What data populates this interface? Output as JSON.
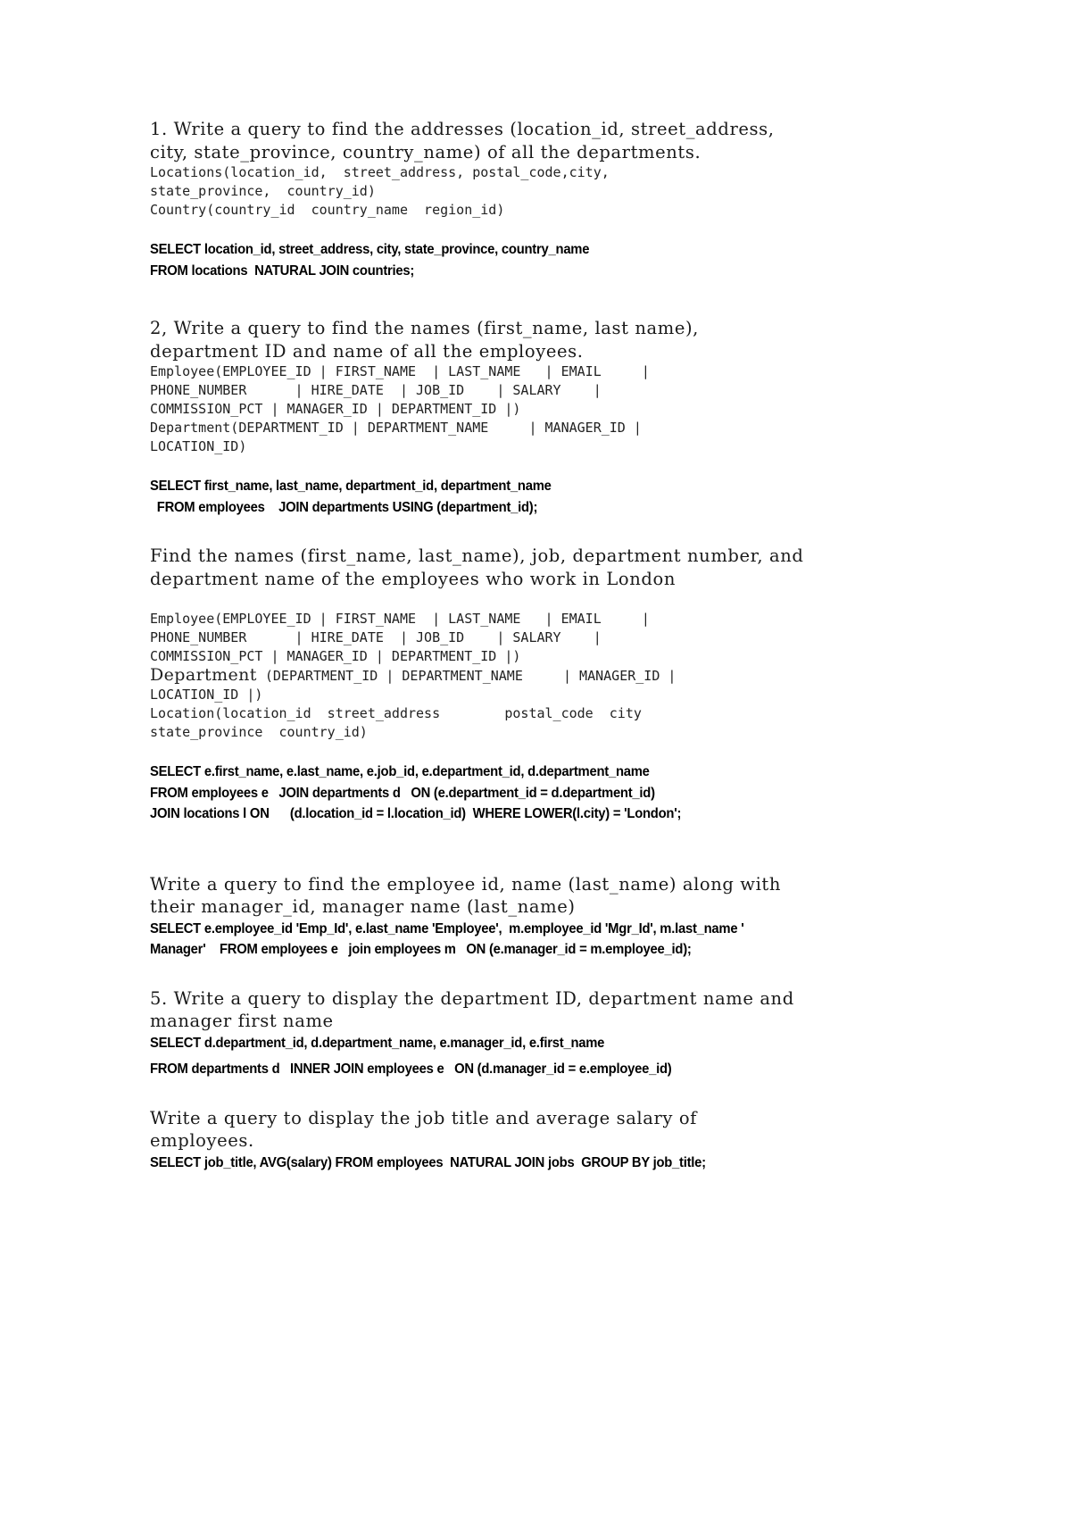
{
  "document": {
    "title": "SQL Joins Exercise Answer Sheet",
    "page_background": "#ffffff",
    "text_color": "#000000"
  },
  "sections": [
    {
      "id": "q1",
      "question": "1. Write a query to find the addresses (location_id, street_address,\ncity, state_province, country_name) of all the departments.",
      "schema_lines": [
        "Locations(location_id,  street_address, postal_code,city,",
        "state_province,  country_id)",
        "Country(country_id  country_name  region_id)"
      ],
      "answer_lines": [
        "SELECT location_id, street_address, city, state_province, country_name",
        "FROM locations  NATURAL JOIN countries;"
      ]
    },
    {
      "id": "q2",
      "question": "2, Write a query to find the names (first_name, last name),\ndepartment ID and name of all the employees.",
      "schema_lines": [
        "Employee(EMPLOYEE_ID | FIRST_NAME  | LAST_NAME   | EMAIL     |",
        "PHONE_NUMBER      | HIRE_DATE  | JOB_ID    | SALARY    |",
        "COMMISSION_PCT | MANAGER_ID | DEPARTMENT_ID |)",
        "Department(DEPARTMENT_ID | DEPARTMENT_NAME     | MANAGER_ID |",
        "LOCATION_ID)"
      ],
      "answer_lines": [
        "SELECT first_name, last_name, department_id, department_name",
        "  FROM employees    JOIN departments USING (department_id);"
      ]
    },
    {
      "id": "q3",
      "question": "Find the names (first_name, last_name), job, department number, and\ndepartment name of the employees who work in London",
      "schema_lines": [
        "Employee(EMPLOYEE_ID | FIRST_NAME  | LAST_NAME   | EMAIL     |",
        "PHONE_NUMBER      | HIRE_DATE  | JOB_ID    | SALARY    |",
        "COMMISSION_PCT | MANAGER_ID | DEPARTMENT_ID |)",
        "Department (DEPARTMENT_ID | DEPARTMENT_NAME     | MANAGER_ID |",
        "LOCATION_ID |)",
        "Location(location_id  street_address        postal_code  city",
        "state_province  country_id)"
      ],
      "schema_serif_prefix": "Department",
      "answer_lines": [
        "SELECT e.first_name, e.last_name, e.job_id, e.department_id, d.department_name",
        "FROM employees e   JOIN departments d   ON (e.department_id = d.department_id)",
        "JOIN locations l ON      (d.location_id = l.location_id)  WHERE LOWER(l.city) = 'London';"
      ]
    },
    {
      "id": "q4",
      "question": "Write a query to find the employee id, name (last_name) along with\ntheir manager_id, manager name (last_name)",
      "schema_lines": [],
      "answer_lines": [
        "SELECT e.employee_id 'Emp_Id', e.last_name 'Employee',  m.employee_id 'Mgr_Id', m.last_name '",
        "Manager'    FROM employees e   join employees m   ON (e.manager_id = m.employee_id);"
      ]
    },
    {
      "id": "q5",
      "question": "5. Write a query to display the department ID, department name and\nmanager first name",
      "schema_lines": [],
      "answer_lines": [
        "SELECT d.department_id, d.department_name, e.manager_id, e.first_name",
        "FROM departments d   INNER JOIN employees e   ON (d.manager_id = e.employee_id)"
      ]
    },
    {
      "id": "q6",
      "question": "Write a query to display the job title and average salary of\nemployees.",
      "schema_lines": [],
      "answer_lines": [
        "SELECT job_title, AVG(salary) FROM employees  NATURAL JOIN jobs  GROUP BY job_title;"
      ]
    }
  ]
}
